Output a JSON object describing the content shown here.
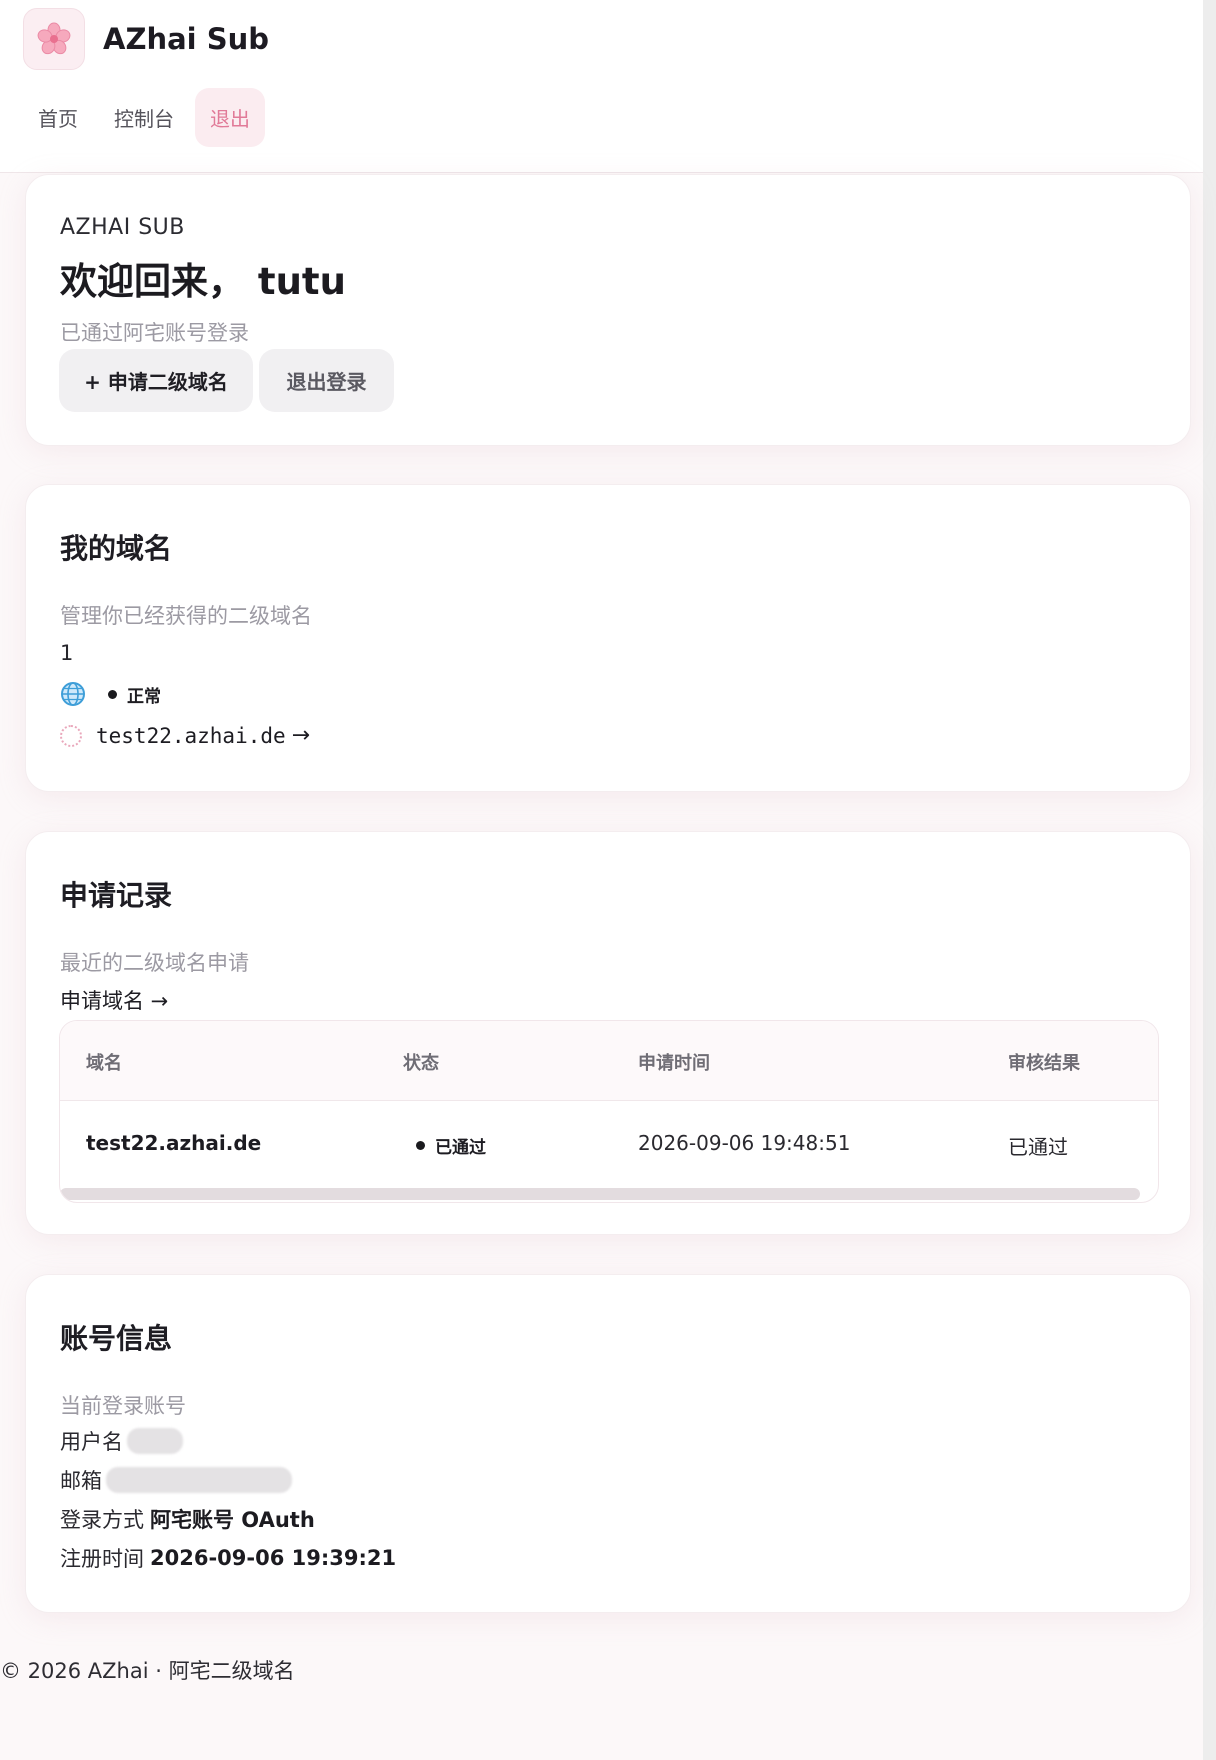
{
  "header": {
    "brand_name": "AZhai Sub",
    "logo_icon": "sakura-flower-icon",
    "nav": [
      {
        "label": "首页"
      },
      {
        "label": "控制台"
      },
      {
        "label": "退出"
      }
    ],
    "active_nav": "退出",
    "accent_color": "#e17a98"
  },
  "welcome_card": {
    "eyebrow": "AZHAI SUB",
    "title": "欢迎回来， tutu",
    "subtitle": "已通过阿宅账号登录",
    "apply_button": "+ 申请二级域名",
    "logout_button": "退出登录"
  },
  "domains_card": {
    "title": "我的域名",
    "description": "管理你已经获得的二级域名",
    "count": "1",
    "status_label": "正常",
    "domain": "test22.azhai.de",
    "arrow": "→"
  },
  "applications_card": {
    "title": "申请记录",
    "description": "最近的二级域名申请",
    "apply_link": "申请域名 →",
    "columns": [
      "域名",
      "状态",
      "申请时间",
      "审核结果"
    ],
    "rows": [
      {
        "domain": "test22.azhai.de",
        "status": "已通过",
        "time": "2026-09-06 19:48:51",
        "result": "已通过"
      }
    ]
  },
  "account_card": {
    "title": "账号信息",
    "description": "当前登录账号",
    "username_label": "用户名",
    "email_label": "邮箱",
    "login_method_label": "登录方式",
    "login_method_value": "阿宅账号 OAuth",
    "registered_label": "注册时间",
    "registered_value": "2026-09-06 19:39:21"
  },
  "footer": {
    "text": "© 2026 AZhai · 阿宅二级域名"
  }
}
